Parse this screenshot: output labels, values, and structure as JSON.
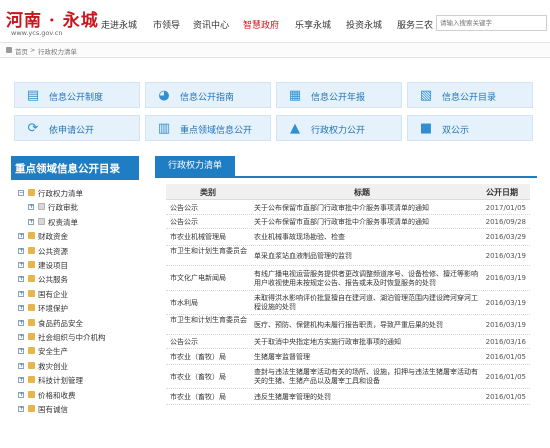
{
  "header": {
    "logo_title": "河南 · 永城",
    "logo_url": "www.ycs.gov.cn",
    "nav": [
      {
        "label": "走进永城",
        "active": false
      },
      {
        "label": "市领导",
        "active": false
      },
      {
        "label": "资讯中心",
        "active": false
      },
      {
        "label": "智慧政府",
        "active": true
      },
      {
        "label": "乐享永城",
        "active": false
      },
      {
        "label": "投资永城",
        "active": false
      },
      {
        "label": "服务三农",
        "active": false
      }
    ],
    "search_placeholder": "请输入搜索关键字"
  },
  "breadcrumb": {
    "home": "首页",
    "sep": ">",
    "current": "行政权力清单"
  },
  "tiles": [
    {
      "label": "信息公开制度",
      "icon": "document-icon"
    },
    {
      "label": "信息公开指南",
      "icon": "compass-icon"
    },
    {
      "label": "信息公开年报",
      "icon": "report-icon"
    },
    {
      "label": "信息公开目录",
      "icon": "catalog-icon"
    },
    {
      "label": "依申请公开",
      "icon": "refresh-icon"
    },
    {
      "label": "重点领域信息公开",
      "icon": "book-icon"
    },
    {
      "label": "行政权力公开",
      "icon": "building-icon"
    },
    {
      "label": "双公示",
      "icon": "certificate-icon"
    }
  ],
  "sidebar": {
    "title": "重点领域信息公开目录",
    "items": [
      {
        "label": "行政权力清单",
        "level": 0,
        "expanded": true
      },
      {
        "label": "行政审批",
        "level": 1,
        "expanded": false
      },
      {
        "label": "权责清单",
        "level": 1,
        "expanded": false
      },
      {
        "label": "财政资金",
        "level": 0,
        "expanded": false
      },
      {
        "label": "公共资源",
        "level": 0,
        "expanded": false
      },
      {
        "label": "建设项目",
        "level": 0,
        "expanded": false
      },
      {
        "label": "公共服务",
        "level": 0,
        "expanded": false
      },
      {
        "label": "国有企业",
        "level": 0,
        "expanded": false
      },
      {
        "label": "环境保护",
        "level": 0,
        "expanded": false
      },
      {
        "label": "食品药品安全",
        "level": 0,
        "expanded": false
      },
      {
        "label": "社会组织与中介机构",
        "level": 0,
        "expanded": false
      },
      {
        "label": "安全生产",
        "level": 0,
        "expanded": false
      },
      {
        "label": "救灾创业",
        "level": 0,
        "expanded": false
      },
      {
        "label": "科技计划管理",
        "level": 0,
        "expanded": false
      },
      {
        "label": "价格和收费",
        "level": 0,
        "expanded": false
      },
      {
        "label": "国有诚信",
        "level": 0,
        "expanded": false
      }
    ]
  },
  "main": {
    "tab": "行政权力清单",
    "columns": [
      "类别",
      "标题",
      "公开日期"
    ],
    "rows": [
      {
        "category": "公告公示",
        "title": "关于公布保留市直部门行政审批中介服务事项清单的通知",
        "date": "2017/01/05"
      },
      {
        "category": "公告公示",
        "title": "关于公布保留市直部门行政审批中介服务事项清单的通知",
        "date": "2016/09/28"
      },
      {
        "category": "市农业机械管理局",
        "title": "农业机械事故现场勘验、检查",
        "date": "2016/03/29"
      },
      {
        "category": "市卫生和计划生育委员会",
        "title": "单采血浆站血液制品管理的监罚",
        "date": "2016/03/19"
      },
      {
        "category": "市文化广电新闻局",
        "title": "有线广播电视运营服务提供者更改调整频道序号、设备检修、擅迁等影响用户收视使用未按规定公告、报告或未及时恢复服务的处罚",
        "date": "2016/03/19"
      },
      {
        "category": "市水利局",
        "title": "未取得洪水影响评价批复擅自在建河道、湖泊管理范围内建设跨河穿河工程设施的处罚",
        "date": "2016/03/19"
      },
      {
        "category": "市卫生和计划生育委员会",
        "title": "医疗、预防、保健机构未履行报告职责，导致严重后果的处罚",
        "date": "2016/03/19"
      },
      {
        "category": "公告公示",
        "title": "关于取消中央指定地方实施行政审批事项的通知",
        "date": "2016/03/16"
      },
      {
        "category": "市农业（畜牧）局",
        "title": "生猪屠宰监督管理",
        "date": "2016/01/05"
      },
      {
        "category": "市农业（畜牧）局",
        "title": "查封与违法生猪屠宰活动有关的场所、设施，扣押与违法生猪屠宰活动有关的生猪、生猪产品以及屠宰工具和设备",
        "date": "2016/01/05"
      },
      {
        "category": "市农业（畜牧）局",
        "title": "违反生猪屠宰管理的处罚",
        "date": "2016/01/05"
      }
    ]
  }
}
